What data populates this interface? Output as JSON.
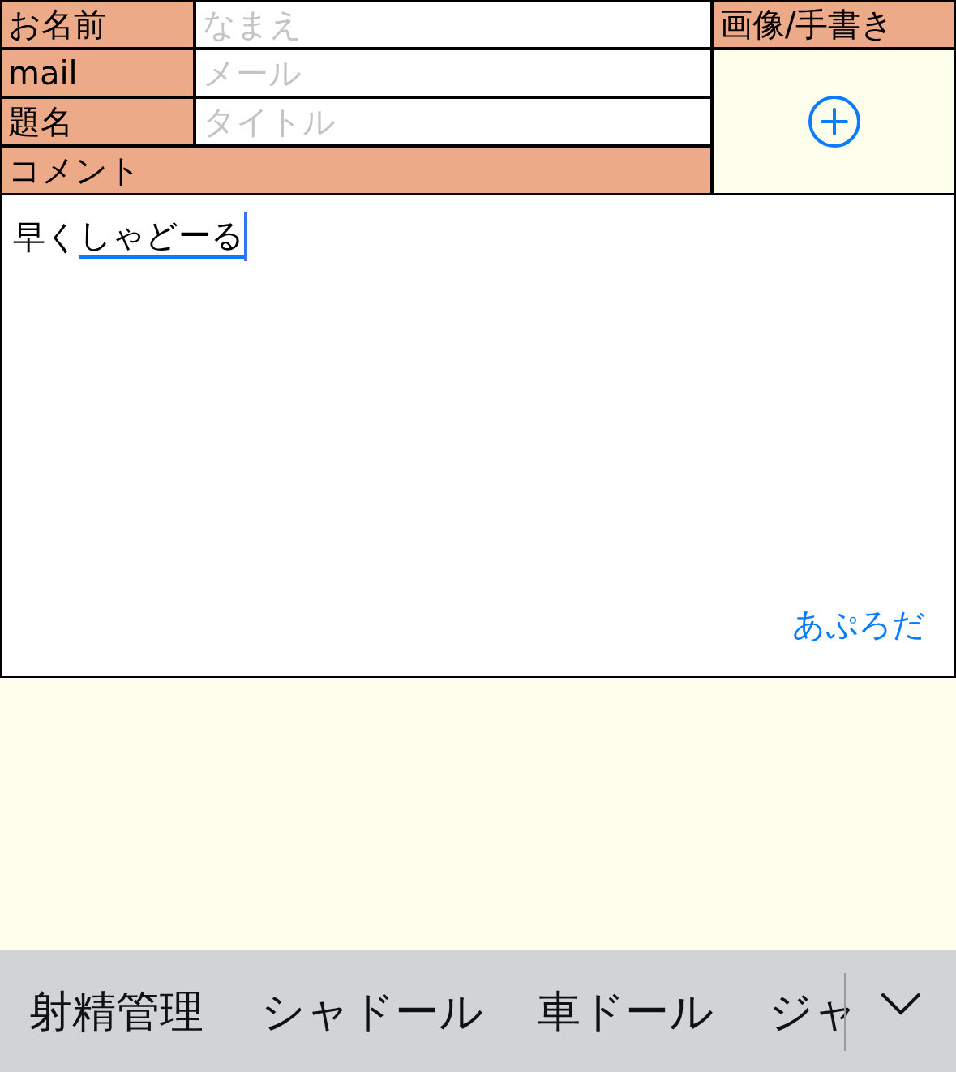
{
  "form": {
    "fields": [
      {
        "label": "お名前",
        "placeholder": "なまえ"
      },
      {
        "label": "mail",
        "placeholder": "メール"
      },
      {
        "label": "題名",
        "placeholder": "タイトル"
      }
    ],
    "image_header": "画像/手書き",
    "comment_label": "コメント",
    "comment": {
      "committed": "早く",
      "composing": "しゃどーる"
    },
    "uploader_link": "あぷろだ"
  },
  "keyboard": {
    "suggestions": [
      "射精管理",
      "シャドール",
      "車ドール",
      "ジャ"
    ]
  }
}
